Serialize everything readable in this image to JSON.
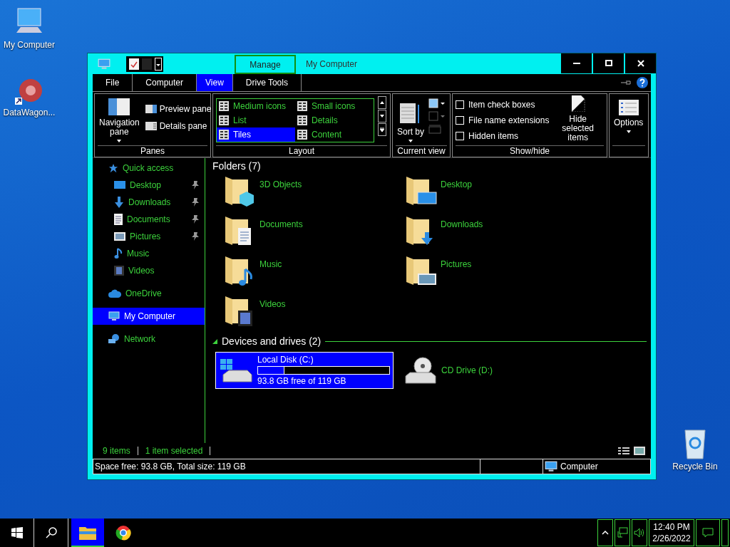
{
  "desktop_icons": [
    {
      "label": "My Computer",
      "kind": "computer"
    },
    {
      "label": "DataWagon...",
      "kind": "shortcut"
    },
    {
      "label": "Recycle Bin",
      "kind": "recycle"
    }
  ],
  "window": {
    "title": "My Computer",
    "context_tab": "Manage"
  },
  "ribbon_tabs": [
    {
      "label": "File",
      "selected": false
    },
    {
      "label": "Computer",
      "selected": false
    },
    {
      "label": "View",
      "selected": true
    },
    {
      "label": "Drive Tools",
      "selected": false
    }
  ],
  "ribbon": {
    "panes": {
      "label": "Panes",
      "navigation": "Navigation pane",
      "preview": "Preview pane",
      "details": "Details pane"
    },
    "layout": {
      "label": "Layout",
      "options": [
        {
          "label": "Medium icons",
          "selected": false
        },
        {
          "label": "Small icons",
          "selected": false
        },
        {
          "label": "List",
          "selected": false
        },
        {
          "label": "Details",
          "selected": false
        },
        {
          "label": "Tiles",
          "selected": true
        },
        {
          "label": "Content",
          "selected": false
        }
      ]
    },
    "current_view": {
      "label": "Current view",
      "sort": "Sort by"
    },
    "show_hide": {
      "label": "Show/hide",
      "checkboxes": [
        {
          "label": "Item check boxes",
          "checked": false
        },
        {
          "label": "File name extensions",
          "checked": false
        },
        {
          "label": "Hidden items",
          "checked": false
        }
      ],
      "hide_selected": "Hide selected items"
    },
    "options": {
      "label": "Options"
    }
  },
  "nav": [
    {
      "label": "Quick access",
      "kind": "star",
      "selected": false,
      "children": [
        {
          "label": "Desktop",
          "kind": "desktop",
          "pinned": true,
          "selected": false
        },
        {
          "label": "Downloads",
          "kind": "downloads",
          "pinned": true,
          "selected": false
        },
        {
          "label": "Documents",
          "kind": "documents",
          "pinned": true,
          "selected": false
        },
        {
          "label": "Pictures",
          "kind": "pictures",
          "pinned": true,
          "selected": false
        },
        {
          "label": "Music",
          "kind": "music",
          "pinned": false,
          "selected": false
        },
        {
          "label": "Videos",
          "kind": "videos",
          "pinned": false,
          "selected": false
        }
      ]
    },
    {
      "label": "OneDrive",
      "kind": "cloud",
      "selected": false
    },
    {
      "label": "My Computer",
      "kind": "computer",
      "selected": true
    },
    {
      "label": "Network",
      "kind": "network",
      "selected": false
    }
  ],
  "folders": {
    "heading": "Folders (7)",
    "items": [
      {
        "label": "3D Objects",
        "kind": "objects"
      },
      {
        "label": "Desktop",
        "kind": "desktop"
      },
      {
        "label": "Documents",
        "kind": "documents"
      },
      {
        "label": "Downloads",
        "kind": "downloads"
      },
      {
        "label": "Music",
        "kind": "music"
      },
      {
        "label": "Pictures",
        "kind": "pictures"
      },
      {
        "label": "Videos",
        "kind": "videos"
      }
    ]
  },
  "drives": {
    "heading": "Devices and drives (2)",
    "items": [
      {
        "name": "Local Disk (C:)",
        "kind": "disk",
        "selected": true,
        "level": 0.2,
        "detail": "93.8 GB free of 119 GB"
      },
      {
        "name": "CD Drive (D:)",
        "kind": "cd",
        "selected": false
      }
    ]
  },
  "status": {
    "count": "9 items",
    "selection": "1 item selected"
  },
  "details_bar": {
    "space": "Space free: 93.8 GB, Total size: 119 GB",
    "location": "Computer"
  },
  "taskbar": {
    "apps": [
      {
        "kind": "explorer",
        "selected": true
      },
      {
        "kind": "browser",
        "selected": false
      }
    ],
    "time": "12:40 PM",
    "date": "2/26/2022"
  }
}
